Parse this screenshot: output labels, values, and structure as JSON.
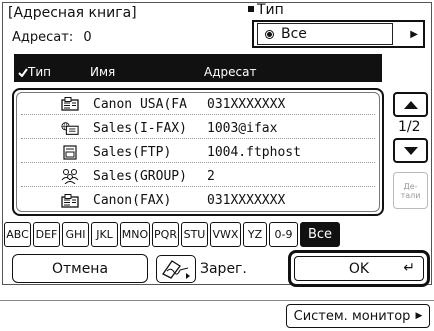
{
  "window": {
    "title": "[Адресная книга]"
  },
  "dest": {
    "label": "Адресат:",
    "count": "0"
  },
  "type": {
    "label": "Тип",
    "value": "Все"
  },
  "columns": {
    "type": "Тип",
    "name": "Имя",
    "address": "Адресат"
  },
  "rows": [
    {
      "icon": "fax-icon",
      "name": "Canon USA(FA",
      "address": "031XXXXXXX"
    },
    {
      "icon": "ifax-icon",
      "name": "Sales(I-FAX)",
      "address": "1003@ifax"
    },
    {
      "icon": "ftp-icon",
      "name": "Sales(FTP)",
      "address": "1004.ftphost"
    },
    {
      "icon": "group-icon",
      "name": "Sales(GROUP)",
      "address": "2"
    },
    {
      "icon": "fax-icon",
      "name": "Canon(FAX)",
      "address": "031XXXXXXX"
    }
  ],
  "pager": {
    "page": "1/2",
    "details_line1": "Де-",
    "details_line2": "тали"
  },
  "index_tabs": [
    "ABC",
    "DEF",
    "GHI",
    "JKL",
    "MNO",
    "PQR",
    "STU",
    "VWX",
    "YZ",
    "0-9",
    "Все"
  ],
  "selected_tab": "Все",
  "buttons": {
    "cancel": "Отмена",
    "register": "Зарег.",
    "ok": "OK",
    "system_monitor": "Систем. монитор"
  }
}
